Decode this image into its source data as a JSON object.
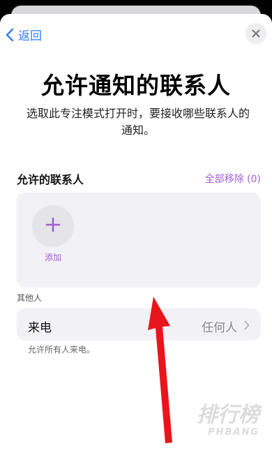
{
  "nav": {
    "back_label": "返回",
    "back_icon": "chevron-left-icon",
    "close_icon": "close-icon"
  },
  "header": {
    "title": "允许通知的联系人",
    "subtitle": "选取此专注模式打开时，要接收哪些联系人的通知。"
  },
  "allowed_contacts": {
    "section_title": "允许的联系人",
    "remove_all_label": "全部移除 (0)",
    "add_label": "添加",
    "add_icon": "plus-icon"
  },
  "others": {
    "section_label": "其他人",
    "calls_label": "来电",
    "calls_value": "任何人",
    "footnote": "允许所有人来电。"
  },
  "watermark": {
    "cn": "排行榜",
    "en": "PHBANG"
  },
  "colors": {
    "accent_blue": "#2f7bf6",
    "accent_purple": "#a05fd1",
    "arrow_red": "#e8161c",
    "card_bg": "#f2f2f6"
  }
}
